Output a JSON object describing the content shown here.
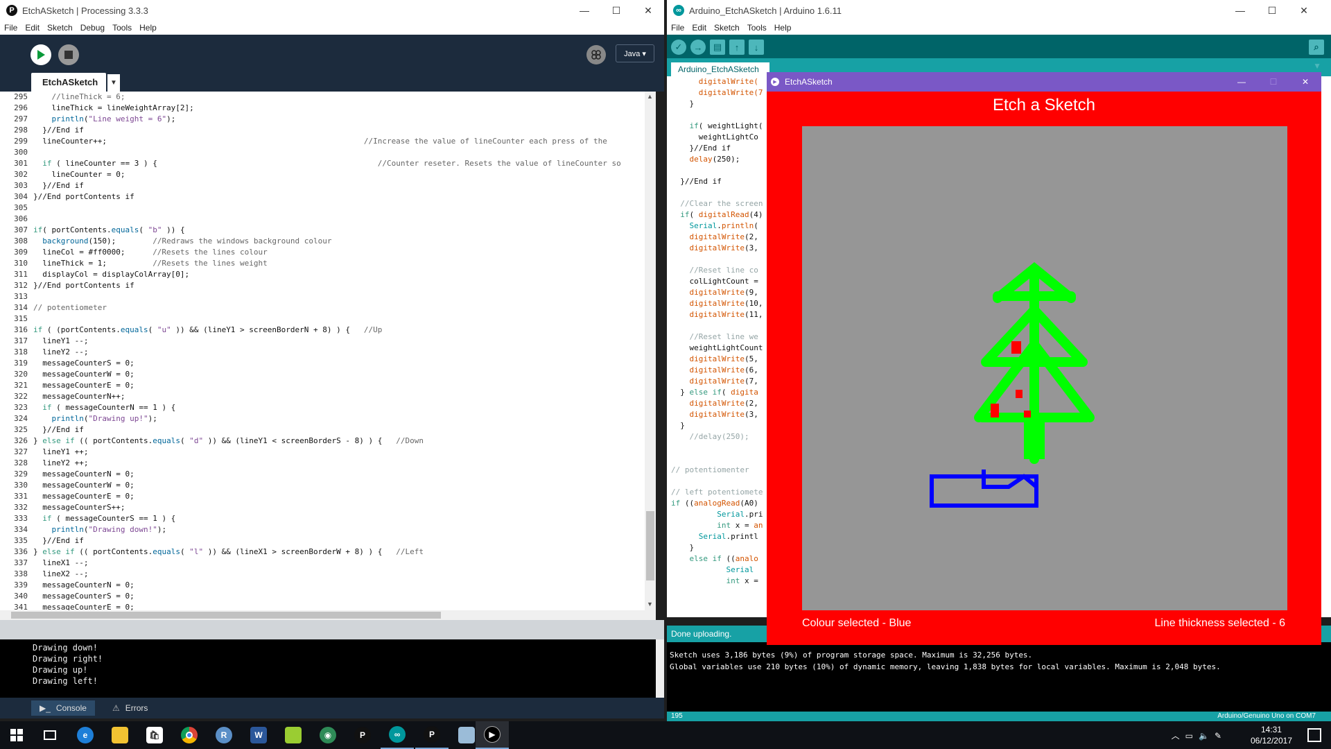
{
  "processing": {
    "title": "EtchASketch | Processing 3.3.3",
    "menu": [
      "File",
      "Edit",
      "Sketch",
      "Debug",
      "Tools",
      "Help"
    ],
    "mode": "Java ▾",
    "tab": "EtchASketch",
    "line_numbers": [
      "295",
      "296",
      "297",
      "298",
      "299",
      "300",
      "301",
      "302",
      "303",
      "304",
      "305",
      "306",
      "307",
      "308",
      "309",
      "310",
      "311",
      "312",
      "313",
      "314",
      "315",
      "316",
      "317",
      "318",
      "319",
      "320",
      "321",
      "322",
      "323",
      "324",
      "325",
      "326",
      "327",
      "328",
      "329",
      "330",
      "331",
      "332",
      "333",
      "334",
      "335",
      "336",
      "337",
      "338",
      "339",
      "340",
      "341"
    ],
    "code": [
      [
        [
          "    //lineThick = 6;",
          "cm"
        ]
      ],
      [
        [
          "    lineThick = lineWeightArray[2];",
          ""
        ]
      ],
      [
        [
          "    ",
          ""
        ],
        [
          "println",
          "fn"
        ],
        [
          "(",
          ""
        ],
        [
          "\"Line weight = 6\"",
          "st"
        ],
        [
          ");",
          ""
        ]
      ],
      [
        [
          "  }//End if",
          ""
        ]
      ],
      [
        [
          "  lineCounter++;                                                        ",
          ""
        ],
        [
          "//Increase the value of lineCounter each press of the",
          "cm"
        ]
      ],
      [
        [
          "",
          ""
        ]
      ],
      [
        [
          "  ",
          ""
        ],
        [
          "if",
          "kw"
        ],
        [
          " ( lineCounter == 3 ) {                                                ",
          ""
        ],
        [
          "//Counter reseter. Resets the value of lineCounter so",
          "cm"
        ]
      ],
      [
        [
          "    lineCounter = 0;",
          ""
        ]
      ],
      [
        [
          "  }//End if",
          ""
        ]
      ],
      [
        [
          "}//End portContents if",
          ""
        ]
      ],
      [
        [
          "",
          ""
        ]
      ],
      [
        [
          "",
          ""
        ]
      ],
      [
        [
          "",
          ""
        ],
        [
          "if",
          "kw"
        ],
        [
          "( portContents.",
          ""
        ],
        [
          "equals",
          "fn"
        ],
        [
          "( ",
          ""
        ],
        [
          "\"b\"",
          "st"
        ],
        [
          " )) {",
          ""
        ]
      ],
      [
        [
          "  ",
          ""
        ],
        [
          "background",
          "fn"
        ],
        [
          "(150);        ",
          ""
        ],
        [
          "//Redraws the windows background colour",
          "cm"
        ]
      ],
      [
        [
          "  lineCol = #ff0000;      ",
          ""
        ],
        [
          "//Resets the lines colour",
          "cm"
        ]
      ],
      [
        [
          "  lineThick = 1;          ",
          ""
        ],
        [
          "//Resets the lines weight",
          "cm"
        ]
      ],
      [
        [
          "  displayCol = displayColArray[0];",
          ""
        ]
      ],
      [
        [
          "}//End portContents if",
          ""
        ]
      ],
      [
        [
          "",
          ""
        ]
      ],
      [
        [
          "// potentiometer",
          "cm"
        ]
      ],
      [
        [
          "",
          ""
        ]
      ],
      [
        [
          "",
          ""
        ],
        [
          "if",
          "kw"
        ],
        [
          " ( (portContents.",
          ""
        ],
        [
          "equals",
          "fn"
        ],
        [
          "( ",
          ""
        ],
        [
          "\"u\"",
          "st"
        ],
        [
          " )) && (lineY1 > screenBorderN + 8) ) {   ",
          ""
        ],
        [
          "//Up",
          "cm"
        ]
      ],
      [
        [
          "  lineY1 --;",
          ""
        ]
      ],
      [
        [
          "  lineY2 --;",
          ""
        ]
      ],
      [
        [
          "  messageCounterS = 0;",
          ""
        ]
      ],
      [
        [
          "  messageCounterW = 0;",
          ""
        ]
      ],
      [
        [
          "  messageCounterE = 0;",
          ""
        ]
      ],
      [
        [
          "  messageCounterN++;",
          ""
        ]
      ],
      [
        [
          "  ",
          ""
        ],
        [
          "if",
          "kw"
        ],
        [
          " ( messageCounterN == 1 ) {",
          ""
        ]
      ],
      [
        [
          "    ",
          ""
        ],
        [
          "println",
          "fn"
        ],
        [
          "(",
          ""
        ],
        [
          "\"Drawing up!\"",
          "st"
        ],
        [
          ");",
          ""
        ]
      ],
      [
        [
          "  }//End if",
          ""
        ]
      ],
      [
        [
          "} ",
          ""
        ],
        [
          "else if",
          "kw"
        ],
        [
          " (( portContents.",
          ""
        ],
        [
          "equals",
          "fn"
        ],
        [
          "( ",
          ""
        ],
        [
          "\"d\"",
          "st"
        ],
        [
          " )) && (lineY1 < screenBorderS - 8) ) {   ",
          ""
        ],
        [
          "//Down",
          "cm"
        ]
      ],
      [
        [
          "  lineY1 ++;",
          ""
        ]
      ],
      [
        [
          "  lineY2 ++;",
          ""
        ]
      ],
      [
        [
          "  messageCounterN = 0;",
          ""
        ]
      ],
      [
        [
          "  messageCounterW = 0;",
          ""
        ]
      ],
      [
        [
          "  messageCounterE = 0;",
          ""
        ]
      ],
      [
        [
          "  messageCounterS++;",
          ""
        ]
      ],
      [
        [
          "  ",
          ""
        ],
        [
          "if",
          "kw"
        ],
        [
          " ( messageCounterS == 1 ) {",
          ""
        ]
      ],
      [
        [
          "    ",
          ""
        ],
        [
          "println",
          "fn"
        ],
        [
          "(",
          ""
        ],
        [
          "\"Drawing down!\"",
          "st"
        ],
        [
          ");",
          ""
        ]
      ],
      [
        [
          "  }//End if",
          ""
        ]
      ],
      [
        [
          "} ",
          ""
        ],
        [
          "else if",
          "kw"
        ],
        [
          " (( portContents.",
          ""
        ],
        [
          "equals",
          "fn"
        ],
        [
          "( ",
          ""
        ],
        [
          "\"l\"",
          "st"
        ],
        [
          " )) && (lineX1 > screenBorderW + 8) ) {   ",
          ""
        ],
        [
          "//Left",
          "cm"
        ]
      ],
      [
        [
          "  lineX1 --;",
          ""
        ]
      ],
      [
        [
          "  lineX2 --;",
          ""
        ]
      ],
      [
        [
          "  messageCounterN = 0;",
          ""
        ]
      ],
      [
        [
          "  messageCounterS = 0;",
          ""
        ]
      ],
      [
        [
          "  messageCounterE = 0;",
          ""
        ]
      ]
    ],
    "console": [
      "Drawing down!",
      "Drawing right!",
      "Drawing up!",
      "Drawing left!"
    ],
    "footer_tabs": [
      "Console",
      "Errors"
    ]
  },
  "arduino": {
    "title": "Arduino_EtchASketch | Arduino 1.6.11",
    "menu": [
      "File",
      "Edit",
      "Sketch",
      "Tools",
      "Help"
    ],
    "tab": "Arduino_EtchASketch",
    "code": [
      [
        [
          "      digitalWrite(",
          "ac"
        ]
      ],
      [
        [
          "      digitalWrite(7",
          "ac"
        ]
      ],
      [
        [
          "    }",
          ""
        ]
      ],
      [
        [
          "",
          ""
        ]
      ],
      [
        [
          "    ",
          ""
        ],
        [
          "if",
          "kw"
        ],
        [
          "( weightLight(",
          ""
        ]
      ],
      [
        [
          "      weightLightCo",
          ""
        ]
      ],
      [
        [
          "    }//End if",
          ""
        ]
      ],
      [
        [
          "    ",
          ""
        ],
        [
          "delay",
          "ac"
        ],
        [
          "(250);",
          ""
        ]
      ],
      [
        [
          "",
          ""
        ]
      ],
      [
        [
          "  }//End if",
          ""
        ]
      ],
      [
        [
          "",
          ""
        ]
      ],
      [
        [
          "  //Clear the screen",
          "am"
        ]
      ],
      [
        [
          "  ",
          ""
        ],
        [
          "if",
          "kw"
        ],
        [
          "( ",
          ""
        ],
        [
          "digitalRead",
          "ac"
        ],
        [
          "(4)",
          ""
        ]
      ],
      [
        [
          "    ",
          ""
        ],
        [
          "Serial",
          "ak"
        ],
        [
          ".",
          ""
        ],
        [
          "println",
          "ac"
        ],
        [
          "(",
          ""
        ]
      ],
      [
        [
          "    ",
          ""
        ],
        [
          "digitalWrite",
          "ac"
        ],
        [
          "(2,",
          ""
        ]
      ],
      [
        [
          "    ",
          ""
        ],
        [
          "digitalWrite",
          "ac"
        ],
        [
          "(3,",
          ""
        ]
      ],
      [
        [
          "",
          ""
        ]
      ],
      [
        [
          "    //Reset line co",
          "am"
        ]
      ],
      [
        [
          "    colLightCount =",
          ""
        ]
      ],
      [
        [
          "    ",
          ""
        ],
        [
          "digitalWrite",
          "ac"
        ],
        [
          "(9,",
          ""
        ]
      ],
      [
        [
          "    ",
          ""
        ],
        [
          "digitalWrite",
          "ac"
        ],
        [
          "(10,",
          ""
        ]
      ],
      [
        [
          "    ",
          ""
        ],
        [
          "digitalWrite",
          "ac"
        ],
        [
          "(11,",
          ""
        ]
      ],
      [
        [
          "",
          ""
        ]
      ],
      [
        [
          "    //Reset line we",
          "am"
        ]
      ],
      [
        [
          "    weightLightCount",
          ""
        ]
      ],
      [
        [
          "    ",
          ""
        ],
        [
          "digitalWrite",
          "ac"
        ],
        [
          "(5,",
          ""
        ]
      ],
      [
        [
          "    ",
          ""
        ],
        [
          "digitalWrite",
          "ac"
        ],
        [
          "(6,",
          ""
        ]
      ],
      [
        [
          "    ",
          ""
        ],
        [
          "digitalWrite",
          "ac"
        ],
        [
          "(7,",
          ""
        ]
      ],
      [
        [
          "  } ",
          ""
        ],
        [
          "else if",
          "kw"
        ],
        [
          "( ",
          ""
        ],
        [
          "digita",
          "ac"
        ]
      ],
      [
        [
          "    ",
          ""
        ],
        [
          "digitalWrite",
          "ac"
        ],
        [
          "(2,",
          ""
        ]
      ],
      [
        [
          "    ",
          ""
        ],
        [
          "digitalWrite",
          "ac"
        ],
        [
          "(3,",
          ""
        ]
      ],
      [
        [
          "  }",
          ""
        ]
      ],
      [
        [
          "    //delay(250);",
          "am"
        ]
      ],
      [
        [
          "",
          ""
        ]
      ],
      [
        [
          "",
          ""
        ]
      ],
      [
        [
          "// potentiomenter",
          "am"
        ]
      ],
      [
        [
          "",
          ""
        ]
      ],
      [
        [
          "// left potentiomete",
          "am"
        ]
      ],
      [
        [
          "",
          ""
        ],
        [
          "if",
          "kw"
        ],
        [
          " ((",
          ""
        ],
        [
          "analogRead",
          "ac"
        ],
        [
          "(A0)",
          ""
        ]
      ],
      [
        [
          "          ",
          ""
        ],
        [
          "Serial",
          "ak"
        ],
        [
          ".pri",
          ""
        ]
      ],
      [
        [
          "          ",
          ""
        ],
        [
          "int",
          "kw"
        ],
        [
          " x = ",
          ""
        ],
        [
          "an",
          "ac"
        ]
      ],
      [
        [
          "      ",
          ""
        ],
        [
          "Serial",
          "ak"
        ],
        [
          ".printl",
          ""
        ]
      ],
      [
        [
          "    }",
          ""
        ]
      ],
      [
        [
          "    ",
          ""
        ],
        [
          "else if",
          "kw"
        ],
        [
          " ((",
          ""
        ],
        [
          "analo",
          "ac"
        ]
      ],
      [
        [
          "            ",
          ""
        ],
        [
          "Serial",
          "ak"
        ]
      ],
      [
        [
          "            ",
          ""
        ],
        [
          "int",
          "kw"
        ],
        [
          " x =",
          ""
        ]
      ]
    ],
    "status": "Done uploading.",
    "console": [
      "Sketch uses 3,186 bytes (9%) of program storage space. Maximum is 32,256 bytes.",
      "Global variables use 210 bytes (10%) of dynamic memory, leaving 1,838 bytes for local variables. Maximum is 2,048 bytes."
    ],
    "line_indicator": "195",
    "board": "Arduino/Genuino Uno on COM7"
  },
  "etch": {
    "title": "EtchASketch",
    "heading": "Etch a Sketch",
    "colour_label": "Colour selected - Blue",
    "thickness_label": "Line thickness selected - 6",
    "colors": {
      "frame": "#ff0000",
      "canvas": "#969696",
      "tree": "#00ff00",
      "ornament": "#ff0000",
      "base": "#0000ff"
    }
  },
  "taskbar": {
    "time": "14:31",
    "date": "06/12/2017",
    "apps": [
      "windows-start-icon",
      "task-view-icon",
      "edge-icon",
      "file-explorer-icon",
      "store-icon",
      "chrome-icon",
      "r-icon",
      "word-icon",
      "notepad-icon",
      "gitkraken-icon",
      "processing-icon",
      "arduino-icon",
      "processing-icon",
      "scratchpad-icon",
      "media-player-icon"
    ]
  }
}
